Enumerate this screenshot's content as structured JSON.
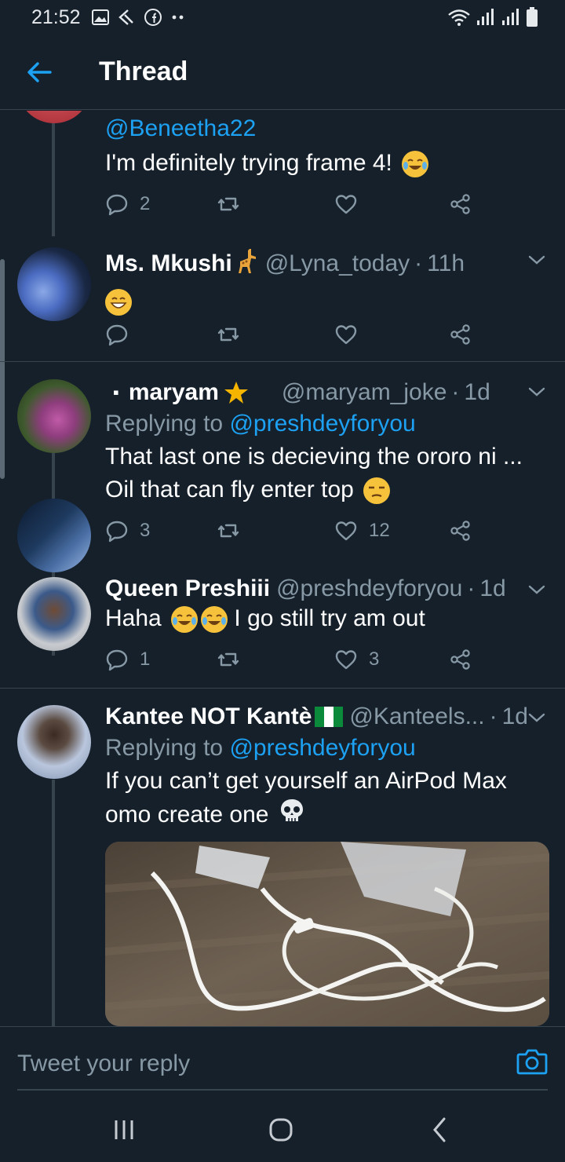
{
  "status": {
    "time": "21:52",
    "icons": [
      "image-icon",
      "missed-call-icon",
      "facebook-icon",
      "more-icon"
    ],
    "right_icons": [
      "wifi-icon",
      "signal-icon",
      "signal-icon",
      "battery-icon"
    ]
  },
  "header": {
    "title": "Thread",
    "back_icon": "back-arrow-icon"
  },
  "colors": {
    "background": "#15202b",
    "accent": "#1da1f2",
    "muted": "#8899a6",
    "divider": "#38444d"
  },
  "tweets": [
    {
      "mention": "@Beneetha22",
      "text": "I'm definitely trying frame 4!",
      "emoji": "joy-emoji",
      "replies": "2",
      "retweets": "",
      "likes": ""
    },
    {
      "name": "Ms. Mkushi",
      "name_emoji": "giraffe-emoji",
      "handle": "@Lyna_today",
      "time": "11h",
      "emoji": "grin-emoji",
      "replies": "",
      "retweets": "",
      "likes": ""
    },
    {
      "name": "maryam",
      "name_prefix": "▪",
      "name_emoji": "star-moon-emoji",
      "handle": "@maryam_joke",
      "time": "1d",
      "replying_prefix": "Replying to",
      "replying_handle": "@preshdeyforyou",
      "line1": "That last one is decieving the ororo ni ...",
      "line2": "Oil that can fly enter top",
      "emoji": "unamused-emoji",
      "replies": "3",
      "retweets": "",
      "likes": "12"
    },
    {
      "name": "Queen Preshiii",
      "handle": "@preshdeyforyou",
      "time": "1d",
      "text_before": "Haha",
      "text_after": "I go still try am out",
      "emoji": "joy-emoji",
      "replies": "1",
      "retweets": "",
      "likes": "3"
    },
    {
      "name": "Kantee NOT Kantè",
      "name_emoji": "nigeria-flag-emoji",
      "handle": "@Kanteels...",
      "time": "1d",
      "replying_prefix": "Replying to",
      "replying_handle": "@preshdeyforyou",
      "line1": "If you can’t get yourself an AirPod Max",
      "line2": "omo create one",
      "emoji": "skull-emoji",
      "media": "photo"
    }
  ],
  "reply": {
    "placeholder": "Tweet your reply",
    "camera_icon": "camera-icon"
  },
  "nav": [
    "recent-apps-icon",
    "home-icon",
    "back-icon"
  ]
}
